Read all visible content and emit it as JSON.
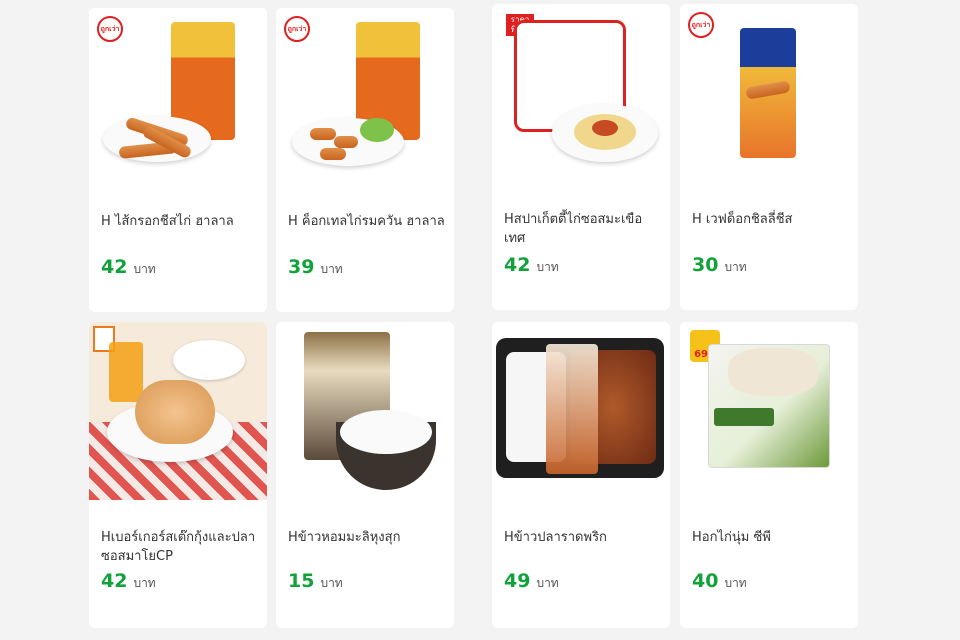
{
  "products": [
    {
      "name": "H ไส้กรอกชีสไก่ ฮาลาล",
      "price": "42",
      "unit": "บาท"
    },
    {
      "name": "H ค็อกเทลไก่รมควัน ฮาลาล",
      "price": "39",
      "unit": "บาท"
    },
    {
      "name": "Hสปาเก็ตตี้ไก่ซอสมะเขือเทศ",
      "price": "42",
      "unit": "บาท"
    },
    {
      "name": "H เวฟด็อกชิลลี่ชีส",
      "price": "30",
      "unit": "บาท"
    },
    {
      "name": "Hเบอร์เกอร์สเต๊กกุ้งและปลาซอสมาโยCP",
      "price": "42",
      "unit": "บาท"
    },
    {
      "name": "Hข้าวหอมมะลิหุงสุก",
      "price": "15",
      "unit": "บาท"
    },
    {
      "name": "Hข้าวปลาราดพริก",
      "price": "49",
      "unit": "บาท"
    },
    {
      "name": "Hอกไก่นุ่ม ซีพี",
      "price": "40",
      "unit": "บาท"
    }
  ],
  "badges": {
    "promo": "ถูกเว่า",
    "special": "ราคาพิเศษ",
    "price_tag": "69.-"
  },
  "colors": {
    "price": "#11a23a",
    "brand_red": "#e02020"
  },
  "icons": [
    "cp-logo-icon",
    "promo-badge-icon",
    "seven-eleven-logo-icon"
  ]
}
